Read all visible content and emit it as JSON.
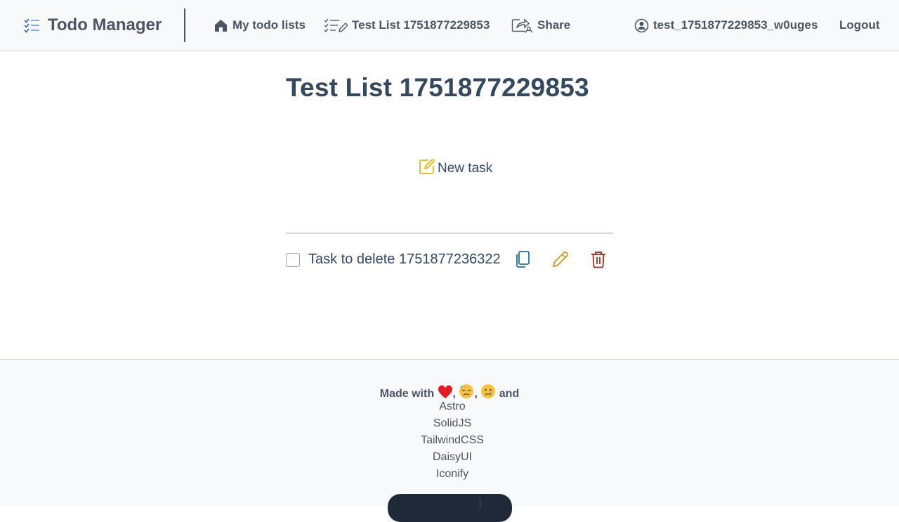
{
  "navbar": {
    "brand_label": "Todo Manager",
    "home_label": "My todo lists",
    "list_label": "Test List 1751877229853",
    "share_label": "Share",
    "user_label": "test_1751877229853_w0uges",
    "logout_label": "Logout"
  },
  "main": {
    "title": "Test List 1751877229853",
    "new_task_label": "New task",
    "tasks": [
      {
        "label": "Task to delete 1751877236322",
        "checked": false
      }
    ]
  },
  "footer": {
    "made_with_prefix": "Made with",
    "made_with_suffix": "and",
    "links": [
      "Astro",
      "SolidJS",
      "TailwindCSS",
      "DaisyUI",
      "Iconify"
    ]
  },
  "colors": {
    "accent_yellow": "#e2b714",
    "copy_blue": "#1f6fa8",
    "edit_gold": "#c99a1c",
    "delete_red": "#9b2c1c",
    "brand_blue": "#3b6fd8"
  }
}
